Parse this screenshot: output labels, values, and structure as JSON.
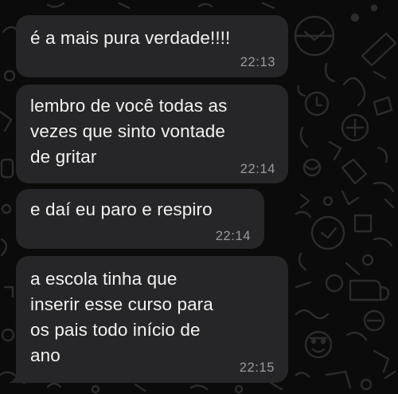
{
  "theme": {
    "background": "#0b0b0b",
    "bubble": "#262628",
    "text": "#f2f2f2",
    "time": "#9a9a9e",
    "doodle": "#2a2a2c"
  },
  "messages": [
    {
      "lines": [
        "é a mais pura verdade!!!!"
      ],
      "time": "22:13"
    },
    {
      "lines": [
        "lembro de você todas as",
        "vezes que sinto vontade",
        "de gritar"
      ],
      "time": "22:14"
    },
    {
      "lines": [
        "e daí eu paro e respiro"
      ],
      "time": "22:14"
    },
    {
      "lines": [
        "a escola tinha que",
        "inserir esse curso para",
        "os pais todo início de",
        "ano"
      ],
      "time": "22:15"
    }
  ]
}
